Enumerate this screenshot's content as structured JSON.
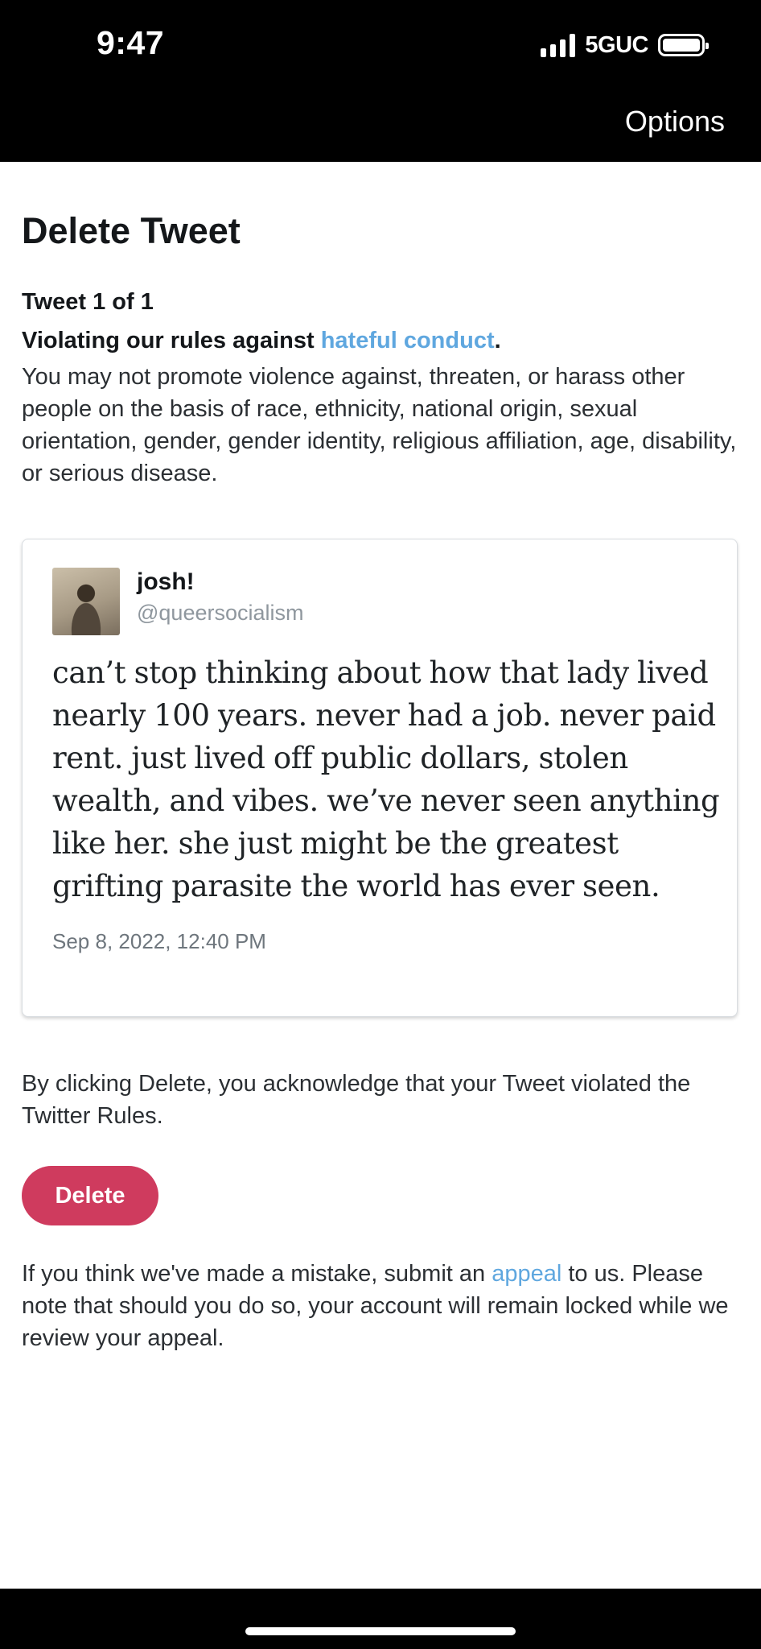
{
  "status_bar": {
    "time": "9:47",
    "network": "5GUC"
  },
  "header": {
    "options_label": "Options"
  },
  "page": {
    "title": "Delete Tweet",
    "counter": "Tweet 1 of 1",
    "violation_prefix": "Violating our rules against ",
    "violation_link": "hateful conduct",
    "violation_suffix": ".",
    "rule_description": "You may not promote violence against, threaten, or harass other people on the basis of race, ethnicity, national origin, sexual orientation, gender, gender identity, religious affiliation, age, disability, or serious disease."
  },
  "tweet": {
    "display_name": "josh!",
    "handle": "@queersocialism",
    "text": "can’t stop thinking about how that lady lived nearly 100 years. never had a job. never paid rent. just lived off public dollars, stolen wealth, and vibes. we’ve never seen anything like her. she just might be the greatest grifting parasite the world has ever seen.",
    "timestamp": "Sep 8, 2022, 12:40 PM"
  },
  "acknowledgement": "By clicking Delete, you acknowledge that your Tweet violated the Twitter Rules.",
  "delete_label": "Delete",
  "appeal": {
    "prefix": "If you think we've made a mistake, submit an ",
    "link": "appeal",
    "suffix": " to us. Please note that should you do so, your account will remain locked while we review your appeal."
  },
  "colors": {
    "link": "#5fa7df",
    "delete_button": "#cf3b5e",
    "bars": "#000000"
  }
}
